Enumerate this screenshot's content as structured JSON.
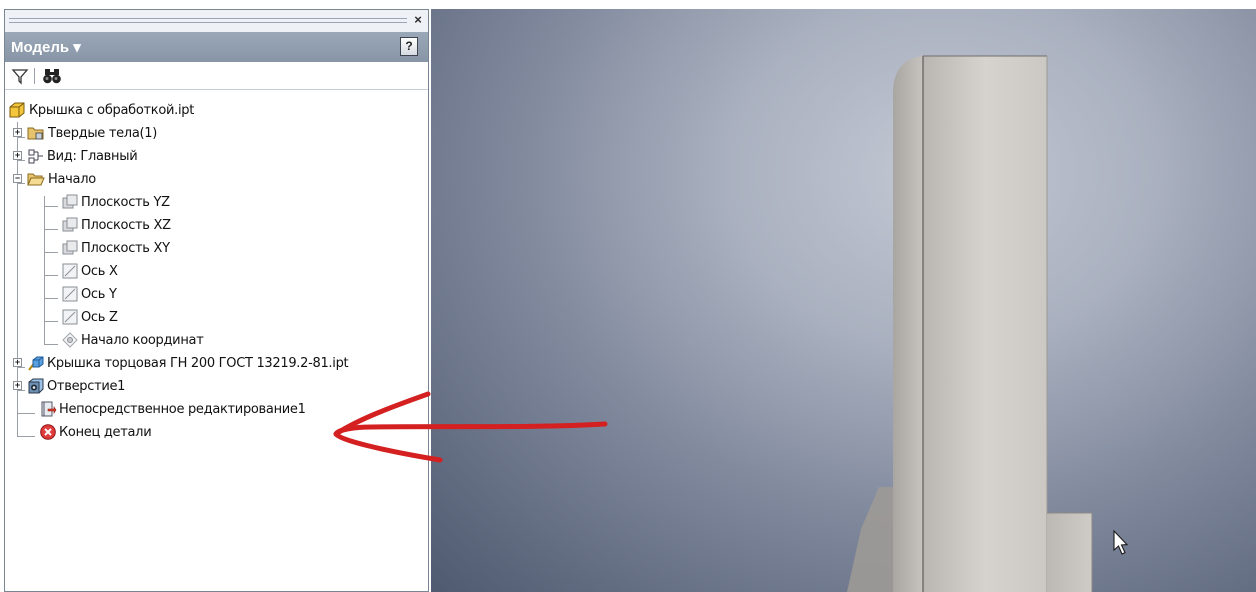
{
  "panel": {
    "close_glyph": "×",
    "title": "Модель ▾",
    "help_glyph": "?",
    "toolbar": {
      "filter_icon": "filter-icon",
      "find_icon": "binoculars-icon"
    }
  },
  "tree": {
    "items": [
      {
        "label": "Крышка с обработкой.ipt",
        "icon": "part-icon"
      },
      {
        "label": "Твердые тела(1)",
        "icon": "solid-bodies-folder-icon"
      },
      {
        "label": "Вид: Главный",
        "icon": "view-icon"
      },
      {
        "label": "Начало",
        "icon": "open-folder-icon"
      },
      {
        "label": "Плоскость YZ",
        "icon": "plane-icon"
      },
      {
        "label": "Плоскость XZ",
        "icon": "plane-icon"
      },
      {
        "label": "Плоскость XY",
        "icon": "plane-icon"
      },
      {
        "label": "Ось X",
        "icon": "axis-icon"
      },
      {
        "label": "Ось Y",
        "icon": "axis-icon"
      },
      {
        "label": "Ось Z",
        "icon": "axis-icon"
      },
      {
        "label": "Начало координат",
        "icon": "point-icon"
      },
      {
        "label": "Крышка торцовая ГН 200 ГОСТ 13219.2-81.ipt",
        "icon": "derived-part-icon"
      },
      {
        "label": "Отверстие1",
        "icon": "hole-icon"
      },
      {
        "label": "Непосредственное редактирование1",
        "icon": "direct-edit-icon"
      },
      {
        "label": "Конец детали",
        "icon": "end-of-part-icon"
      }
    ]
  },
  "colors": {
    "annotation_arrow": "#d42020",
    "panel_title_bg": "#8f9cad",
    "viewport_dark": "#4f596f"
  }
}
